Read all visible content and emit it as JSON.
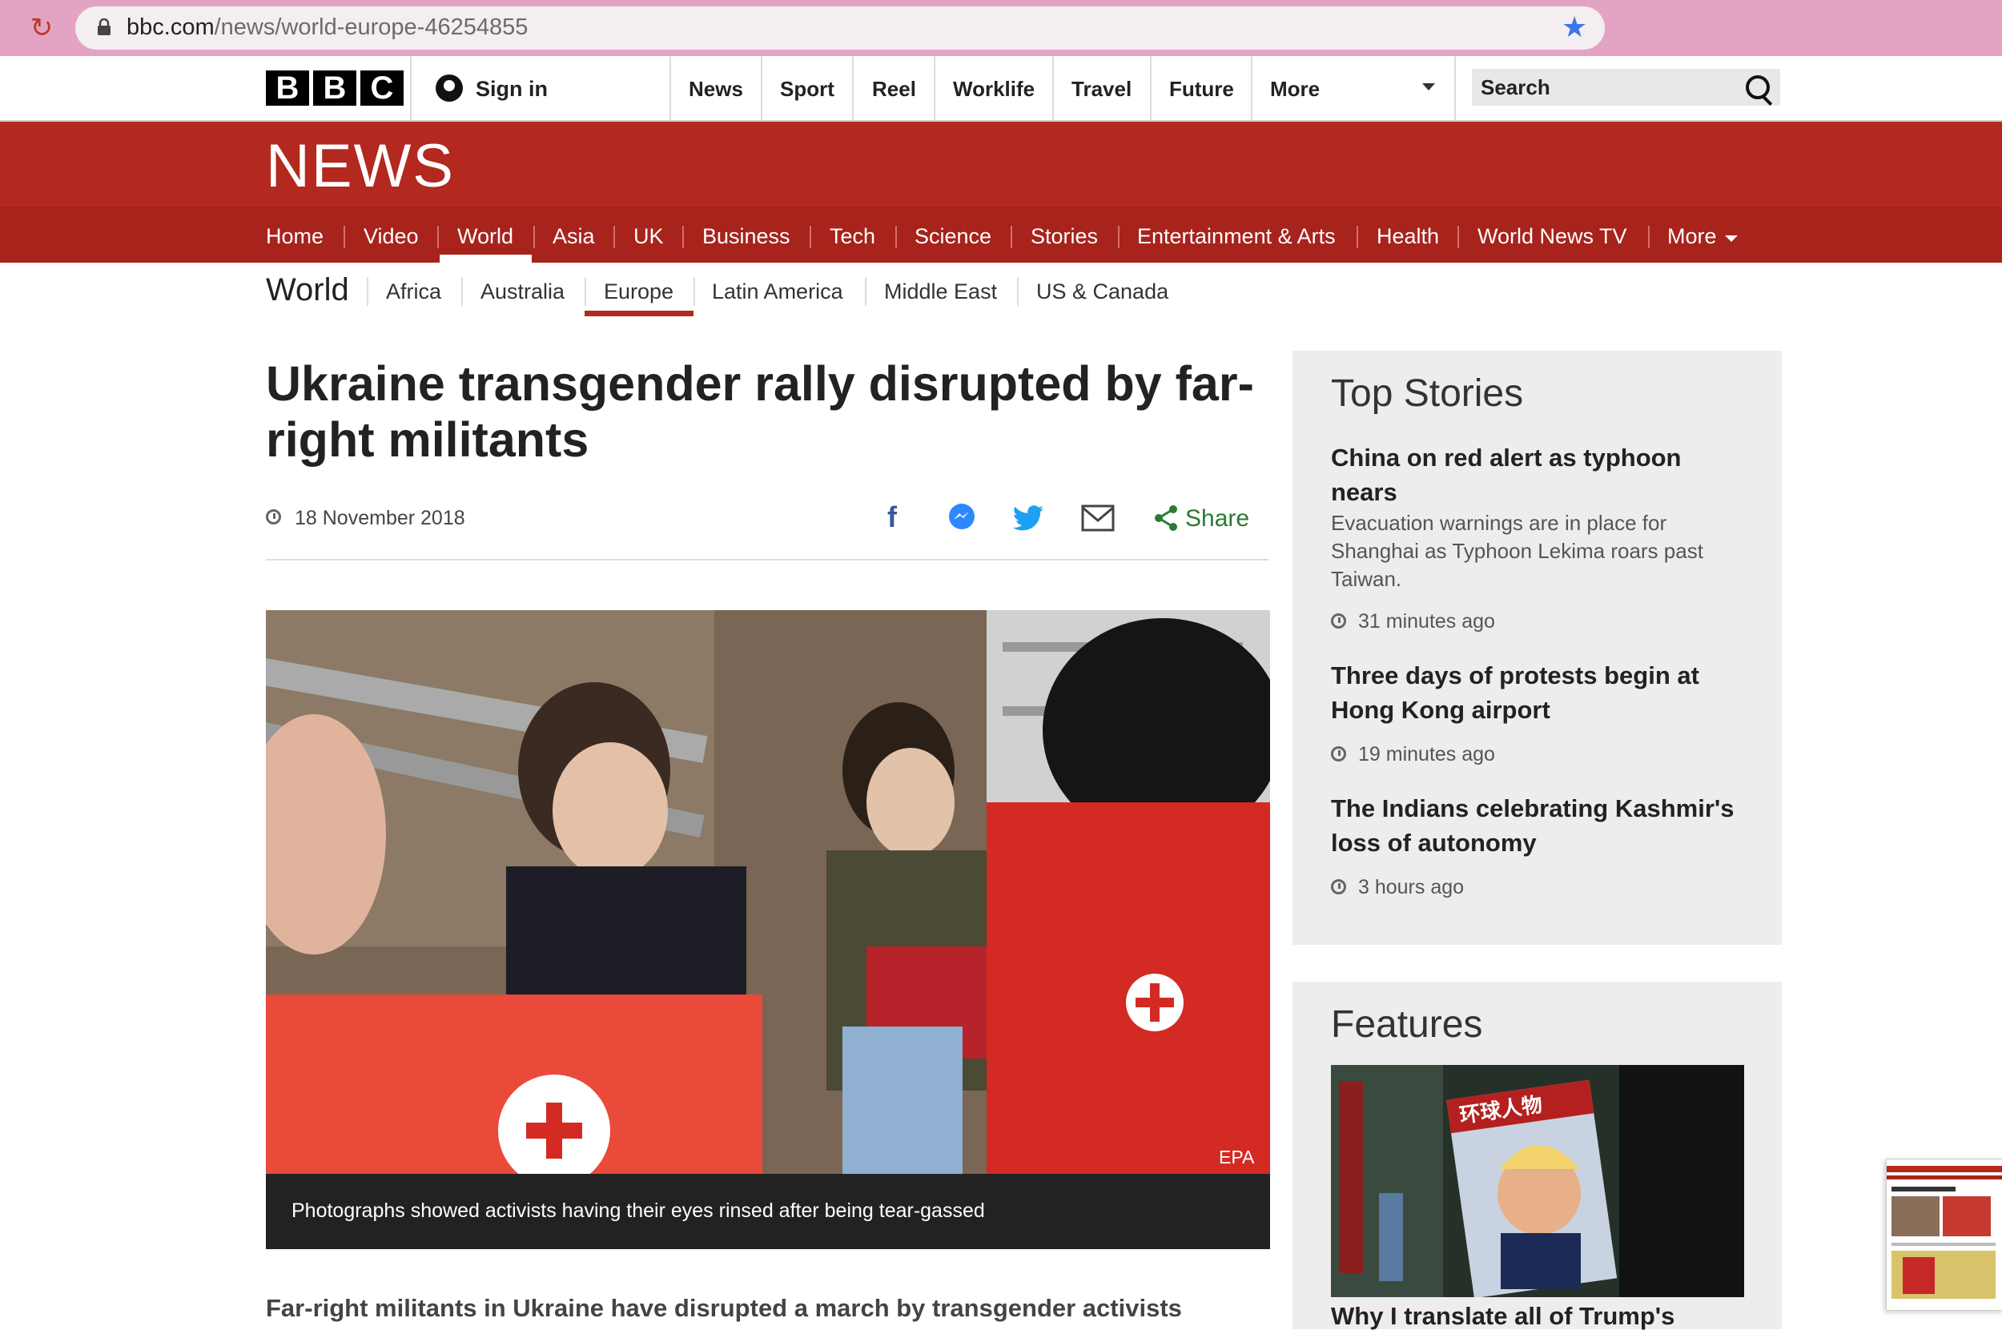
{
  "browser": {
    "url_domain": "bbc.com",
    "url_path": "/news/world-europe-46254855"
  },
  "bbc_nav": {
    "logo_letters": [
      "B",
      "B",
      "C"
    ],
    "signin": "Sign in",
    "links": [
      "News",
      "Sport",
      "Reel",
      "Worklife",
      "Travel",
      "Future",
      "More"
    ],
    "search_placeholder": "Search"
  },
  "news": {
    "logo": "NEWS",
    "subnav": [
      "Home",
      "Video",
      "World",
      "Asia",
      "UK",
      "Business",
      "Tech",
      "Science",
      "Stories",
      "Entertainment & Arts",
      "Health",
      "World News TV",
      "More"
    ],
    "active": "World"
  },
  "world": {
    "title": "World",
    "links": [
      "Africa",
      "Australia",
      "Europe",
      "Latin America",
      "Middle East",
      "US & Canada"
    ],
    "active": "Europe"
  },
  "article": {
    "headline": "Ukraine transgender rally disrupted by far-right militants",
    "date": "18 November 2018",
    "share_label": "Share",
    "share_icons": [
      "facebook-icon",
      "messenger-icon",
      "twitter-icon",
      "email-icon",
      "share-icon"
    ],
    "image_credit": "EPA",
    "caption": "Photographs showed activists having their eyes rinsed after being tear-gassed",
    "lede": "Far-right militants in Ukraine have disrupted a march by transgender activists"
  },
  "top_stories": {
    "title": "Top Stories",
    "stories": [
      {
        "headline": "China on red alert as typhoon nears",
        "summary": "Evacuation warnings are in place for Shanghai as Typhoon Lekima roars past Taiwan.",
        "time": "31 minutes ago"
      },
      {
        "headline": "Three days of protests begin at Hong Kong airport",
        "summary": "",
        "time": "19 minutes ago"
      },
      {
        "headline": "The Indians celebrating Kashmir's loss of autonomy",
        "summary": "",
        "time": "3 hours ago"
      }
    ]
  },
  "features": {
    "title": "Features",
    "headline": "Why I translate all of Trump's",
    "image_text": "环球人物"
  },
  "colors": {
    "news_red": "#b3281f",
    "subnav_red": "#a7231c",
    "browser_bar": "#e3a4c3",
    "share_green": "#2a7a34"
  }
}
